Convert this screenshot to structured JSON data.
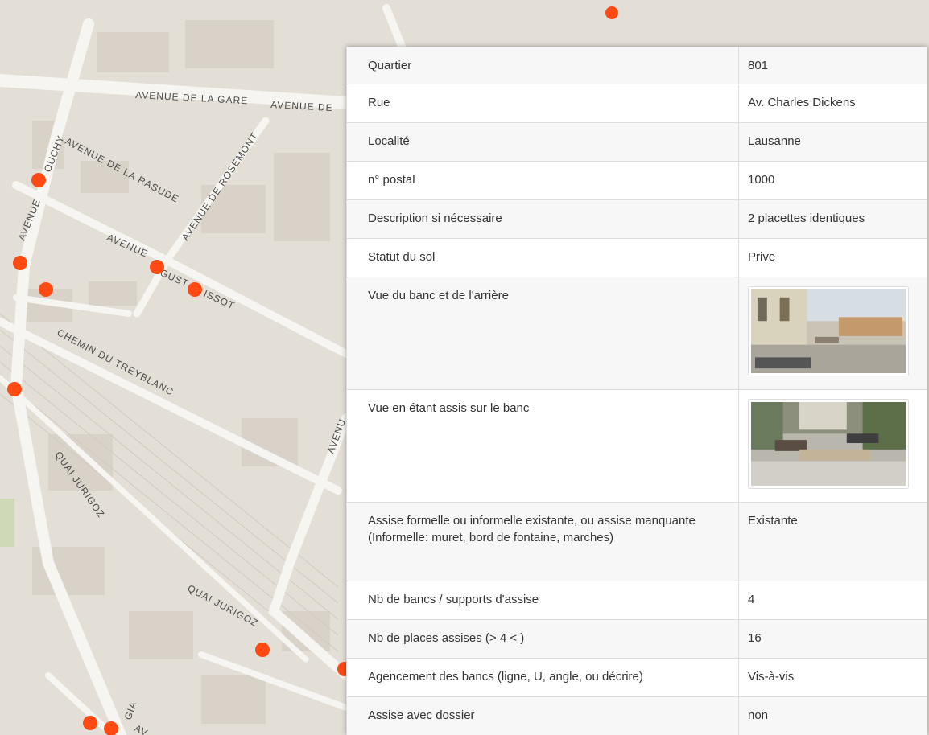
{
  "map": {
    "street_labels": [
      "AVENUE DE LA GARE",
      "AVENUE DE",
      "OUCHY",
      "AVENUE",
      "AVENUE DE LA RASUDE",
      "AVENUE DE ROSEMONT",
      "AVENUE",
      "GUST",
      "ISSOT",
      "CHEMIN DU TREYBLANC",
      "AVENU",
      "QUAI JURIGOZ",
      "QUAI JURIGOZ",
      "GIA",
      "AV"
    ],
    "marker_color": "#ff4a13"
  },
  "details": {
    "rows": [
      {
        "label": "Quartier",
        "value": "801"
      },
      {
        "label": "Rue",
        "value": "Av. Charles Dickens"
      },
      {
        "label": "Localité",
        "value": "Lausanne"
      },
      {
        "label": "n° postal",
        "value": "1000"
      },
      {
        "label": "Description si nécessaire",
        "value": "2 placettes identiques"
      },
      {
        "label": "Statut du sol",
        "value": "Prive"
      },
      {
        "label": "Vue du banc et de l'arrière",
        "value": ""
      },
      {
        "label": "Vue en étant assis sur le banc",
        "value": ""
      },
      {
        "label": "Assise formelle ou informelle existante, ou assise manquante (Informelle: muret, bord de fontaine, marches)",
        "value": "Existante"
      },
      {
        "label": "Nb de bancs / supports d'assise",
        "value": "4"
      },
      {
        "label": "Nb de places assises (> 4 < )",
        "value": "16"
      },
      {
        "label": "Agencement des bancs (ligne, U, angle, ou décrire)",
        "value": "Vis-à-vis"
      },
      {
        "label": "Assise avec dossier",
        "value": "non"
      }
    ]
  }
}
